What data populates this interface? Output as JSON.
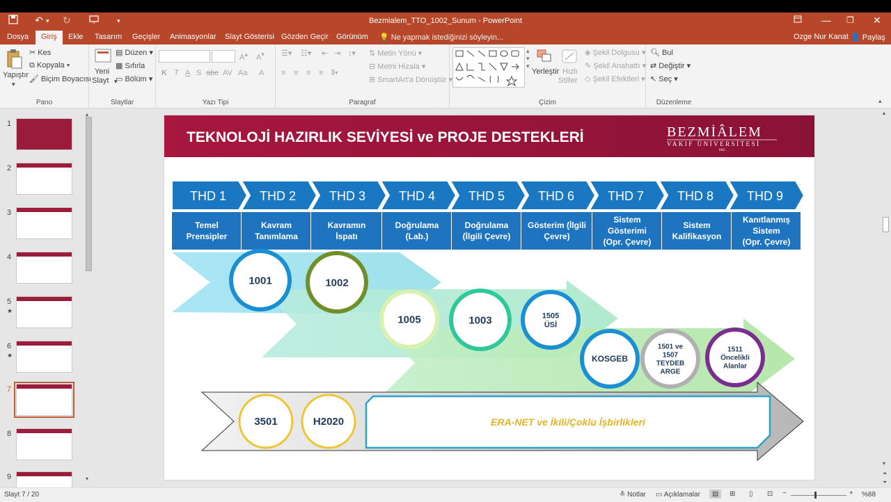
{
  "window": {
    "title": "Bezmialem_TTO_1002_Sunum - PowerPoint"
  },
  "tabs": [
    "Dosya",
    "Giriş",
    "Ekle",
    "Tasarım",
    "Geçişler",
    "Animasyonlar",
    "Slayt Gösterisi",
    "Gözden Geçir",
    "Görünüm"
  ],
  "tell_me": "Ne yapmak istediğinizi söyleyin...",
  "user": "Ozge Nur Kanat",
  "share": "Paylaş",
  "ribbon": {
    "pano": {
      "label": "Pano",
      "paste": "Yapıştır",
      "cut": "Kes",
      "copy": "Kopyala",
      "format_painter": "Biçim Boyacısı"
    },
    "slaytlar": {
      "label": "Slaytlar",
      "new_slide": "Yeni",
      "new_slide2": "Slayt",
      "layout": "Düzen",
      "reset": "Sıfırla",
      "section": "Bölüm"
    },
    "yazi_tipi": {
      "label": "Yazı Tipi"
    },
    "paragraf": {
      "label": "Paragraf",
      "text_direction": "Metin Yönü",
      "align_text": "Metni Hizala",
      "smartart": "SmartArt'a Dönüştür"
    },
    "cizim": {
      "label": "Çizim",
      "arrange": "Yerleştir",
      "quick_styles1": "Hızlı",
      "quick_styles2": "Stiller",
      "shape_fill": "Şekil Dolgusu",
      "shape_outline": "Şekil Anahattı",
      "shape_effects": "Şekil Efektleri"
    },
    "duzenleme": {
      "label": "Düzenleme",
      "find": "Bul",
      "replace": "Değiştir",
      "select": "Seç"
    }
  },
  "thumbnails": [
    "1",
    "2",
    "3",
    "4",
    "5",
    "6",
    "7",
    "8",
    "9"
  ],
  "slide": {
    "title": "TEKNOLOJİ HAZIRLIK SEVİYESİ ve PROJE DESTEKLERİ",
    "logo_main": "BEZMİÂLEM",
    "logo_sub": "VAKIF ÜNİVERSİTESİ",
    "logo_year": "1845",
    "levels": [
      "THD 1",
      "THD 2",
      "THD 3",
      "THD 4",
      "THD 5",
      "THD 6",
      "THD 7",
      "THD 8",
      "THD 9"
    ],
    "level_desc": [
      [
        "Temel",
        "Prensipler"
      ],
      [
        "Kavram",
        "Tanımlama"
      ],
      [
        "Kavramın",
        "İspatı"
      ],
      [
        "Doğrulama",
        "(Lab.)"
      ],
      [
        "Doğrulama",
        "(İlgili Çevre)"
      ],
      [
        "Gösterim (İlgili",
        "Çevre)"
      ],
      [
        "Sistem",
        "Gösterimi",
        "(Opr. Çevre)"
      ],
      [
        "Sistem",
        "Kalifikasyon"
      ],
      [
        "Kanıtlanmış",
        "Sistem",
        "(Opr. Çevre)"
      ]
    ],
    "programs": [
      {
        "l1": "1001",
        "l2": "",
        "border": "#1a8fd1"
      },
      {
        "l1": "1002",
        "l2": "",
        "border": "#6f8f2a"
      },
      {
        "l1": "1005",
        "l2": "",
        "border": "#d8f0b0"
      },
      {
        "l1": "1003",
        "l2": "",
        "border": "#2fc89a"
      },
      {
        "l1": "1505",
        "l2": "ÜSİ",
        "border": "#1a8fd1"
      },
      {
        "l1": "KOSGEB",
        "l2": "",
        "border": "#1a8fd1"
      },
      {
        "l1": "1501 ve",
        "l2": "1507",
        "l3": "TEYDEB",
        "l4": "ARGE",
        "border": "#b0b0b0"
      },
      {
        "l1": "1511",
        "l2": "Öncelikli",
        "l3": "Alanlar",
        "border": "#7a2e8e"
      }
    ],
    "bottom_programs": [
      "3501",
      "H2020"
    ],
    "banner": "ERA-NET ve İkili/Çoklu İşbirlikleri",
    "colors": {
      "title_bar": "#9b1b3a",
      "chevron": "#1a78c2",
      "desc": "#1f74c0",
      "banner_text": "#e6b325",
      "circle_text": "#1f3a5a"
    }
  },
  "status": {
    "slide": "Slayt 7 / 20",
    "notes": "Notlar",
    "comments": "Açıklamalar",
    "zoom": "%88"
  }
}
